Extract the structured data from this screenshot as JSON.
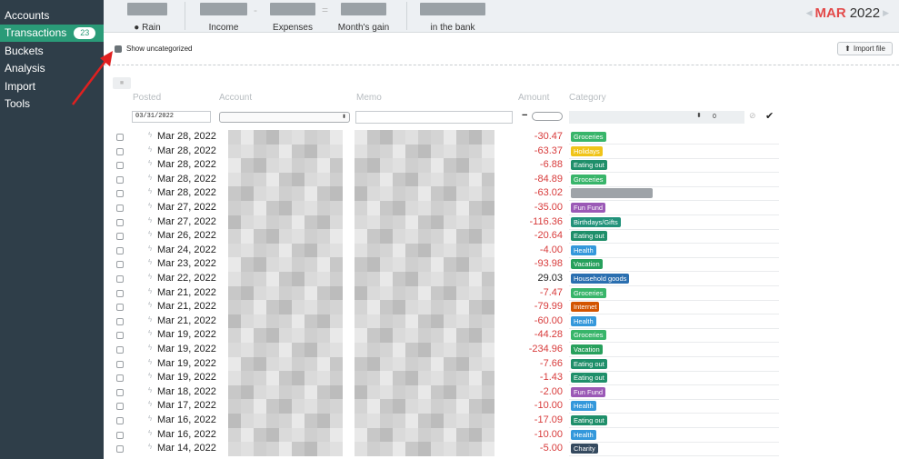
{
  "sidebar": {
    "items": [
      {
        "label": "Accounts",
        "active": false
      },
      {
        "label": "Transactions",
        "active": true,
        "badge": "23"
      },
      {
        "label": "Buckets",
        "active": false
      },
      {
        "label": "Analysis",
        "active": false
      },
      {
        "label": "Import",
        "active": false
      },
      {
        "label": "Tools",
        "active": false
      }
    ]
  },
  "header": {
    "rain_label": "Rain",
    "income_label": "Income",
    "minus_op": "-",
    "expenses_label": "Expenses",
    "equals_op": "=",
    "gain_label": "Month's gain",
    "bank_label": "in the bank",
    "month": "MAR",
    "year": "2022",
    "prev_arrow": "◀",
    "next_arrow": "▶"
  },
  "controls": {
    "show_uncategorized_label": "Show uncategorized",
    "show_uncategorized_checked": true,
    "import_label": "Import file"
  },
  "table": {
    "columns": {
      "posted": "Posted",
      "account": "Account",
      "memo": "Memo",
      "amount": "Amount",
      "category": "Category"
    },
    "filter": {
      "date": "03/31/2022",
      "amount_sign": "−",
      "category_count": "0",
      "category_caret": "⬍"
    },
    "rows": [
      {
        "date": "Mar 28, 2022",
        "amount": "-30.47",
        "category": "Groceries"
      },
      {
        "date": "Mar 28, 2022",
        "amount": "-63.37",
        "category": "Holidays"
      },
      {
        "date": "Mar 28, 2022",
        "amount": "-6.88",
        "category": "Eating out"
      },
      {
        "date": "Mar 28, 2022",
        "amount": "-84.89",
        "category": "Groceries"
      },
      {
        "date": "Mar 28, 2022",
        "amount": "-63.02",
        "category": ""
      },
      {
        "date": "Mar 27, 2022",
        "amount": "-35.00",
        "category": "Fun Fund"
      },
      {
        "date": "Mar 27, 2022",
        "amount": "-116.36",
        "category": "Birthdays/Gifts"
      },
      {
        "date": "Mar 26, 2022",
        "amount": "-20.64",
        "category": "Eating out"
      },
      {
        "date": "Mar 24, 2022",
        "amount": "-4.00",
        "category": "Health"
      },
      {
        "date": "Mar 23, 2022",
        "amount": "-93.98",
        "category": "Vacation"
      },
      {
        "date": "Mar 22, 2022",
        "amount": "29.03",
        "category": "Household goods"
      },
      {
        "date": "Mar 21, 2022",
        "amount": "-7.47",
        "category": "Groceries"
      },
      {
        "date": "Mar 21, 2022",
        "amount": "-79.99",
        "category": "Internet"
      },
      {
        "date": "Mar 21, 2022",
        "amount": "-60.00",
        "category": "Health"
      },
      {
        "date": "Mar 19, 2022",
        "amount": "-44.28",
        "category": "Groceries"
      },
      {
        "date": "Mar 19, 2022",
        "amount": "-234.96",
        "category": "Vacation"
      },
      {
        "date": "Mar 19, 2022",
        "amount": "-7.66",
        "category": "Eating out"
      },
      {
        "date": "Mar 19, 2022",
        "amount": "-1.43",
        "category": "Eating out"
      },
      {
        "date": "Mar 18, 2022",
        "amount": "-2.00",
        "category": "Fun Fund"
      },
      {
        "date": "Mar 17, 2022",
        "amount": "-10.00",
        "category": "Health"
      },
      {
        "date": "Mar 16, 2022",
        "amount": "-17.09",
        "category": "Eating out"
      },
      {
        "date": "Mar 16, 2022",
        "amount": "-10.00",
        "category": "Health"
      },
      {
        "date": "Mar 14, 2022",
        "amount": "-5.00",
        "category": "Charity"
      }
    ]
  },
  "category_colors": {
    "Groceries": "#38b56a",
    "Holidays": "#f0c419",
    "Eating out": "#1f8f6a",
    "Fun Fund": "#9b59b6",
    "Birthdays/Gifts": "#21927a",
    "Health": "#3498db",
    "Vacation": "#27a05c",
    "Household goods": "#2a6fb0",
    "Internet": "#d35400",
    "Charity": "#34495e"
  },
  "colors": {
    "sidebar_bg": "#2f3e49",
    "accent": "#2a9b78",
    "negative": "#d83b3b",
    "month": "#e34a4a",
    "annotation_arrow": "#e02020"
  }
}
